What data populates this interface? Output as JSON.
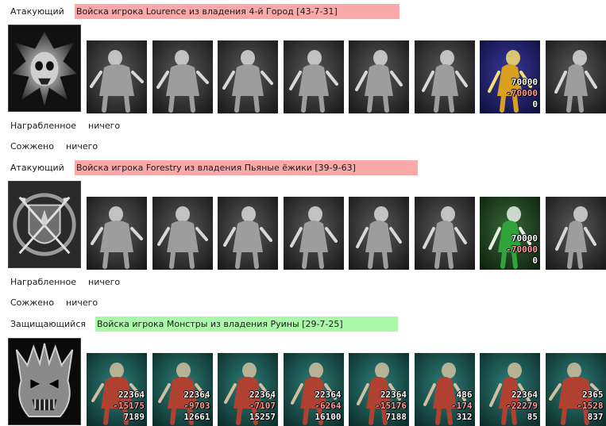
{
  "colors": {
    "attacker_bg": "#f9a9a9",
    "defender_bg": "#a9f9a9",
    "loss": "#ff9a9a"
  },
  "labels": {
    "looted": "Награбленное",
    "burned": "Сожжено",
    "nothing": "ничего"
  },
  "battles": [
    {
      "role": "Атакующий",
      "title": "Войска игрока Lourence из владения 4-й Город [43-7-31]",
      "emblem": "skull-emblem-icon",
      "units": [
        {
          "icon": "ghoul-icon",
          "style": "gray"
        },
        {
          "icon": "skeleton-icon",
          "style": "gray"
        },
        {
          "icon": "ghost-beast-icon",
          "style": "gray"
        },
        {
          "icon": "dragon-icon",
          "style": "gray"
        },
        {
          "icon": "golem-icon",
          "style": "gray"
        },
        {
          "icon": "hooded-warrior-icon",
          "style": "gray"
        },
        {
          "icon": "lich-king-icon",
          "style": "gold",
          "count": "70000",
          "loss": "-70000",
          "left": "0"
        },
        {
          "icon": "wraith-icon",
          "style": "gray"
        }
      ]
    },
    {
      "role": "Атакующий",
      "title": "Войска игрока Forestry из владения Пьяные ёжики [39-9-63]",
      "emblem": "crossed-arrows-emblem-icon",
      "units": [
        {
          "icon": "dwarf-icon",
          "style": "gray"
        },
        {
          "icon": "knight-icon",
          "style": "gray"
        },
        {
          "icon": "centurion-icon",
          "style": "gray"
        },
        {
          "icon": "griffin-icon",
          "style": "gray"
        },
        {
          "icon": "archer-icon",
          "style": "gray"
        },
        {
          "icon": "druid-icon",
          "style": "gray"
        },
        {
          "icon": "green-mage-icon",
          "style": "green",
          "count": "70000",
          "loss": "-70000",
          "left": "0"
        },
        {
          "icon": "sorcerer-icon",
          "style": "gray"
        }
      ]
    },
    {
      "role": "Защищающийся",
      "title": "Войска игрока Монстры из владения Руины [29-7-25]",
      "emblem": "demon-mask-emblem-icon",
      "units": [
        {
          "icon": "beast-rider-icon",
          "style": "teal",
          "count": "22364",
          "loss": "-15175",
          "left": "7189"
        },
        {
          "icon": "armored-demon-icon",
          "style": "teal",
          "count": "22364",
          "loss": "-9703",
          "left": "12661"
        },
        {
          "icon": "orc-warrior-icon",
          "style": "teal",
          "count": "22364",
          "loss": "-7107",
          "left": "15257"
        },
        {
          "icon": "winged-devil-icon",
          "style": "teal",
          "count": "22364",
          "loss": "-6264",
          "left": "16100"
        },
        {
          "icon": "spiked-creature-icon",
          "style": "teal",
          "count": "22364",
          "loss": "-15176",
          "left": "7188"
        },
        {
          "icon": "red-fiend-icon",
          "style": "teal",
          "count": "486",
          "loss": "-174",
          "left": "312"
        },
        {
          "icon": "tower-golem-icon",
          "style": "teal",
          "count": "22364",
          "loss": "-22279",
          "left": "85"
        },
        {
          "icon": "purple-demon-icon",
          "style": "teal",
          "count": "2365",
          "loss": "-1528",
          "left": "837"
        }
      ]
    }
  ]
}
